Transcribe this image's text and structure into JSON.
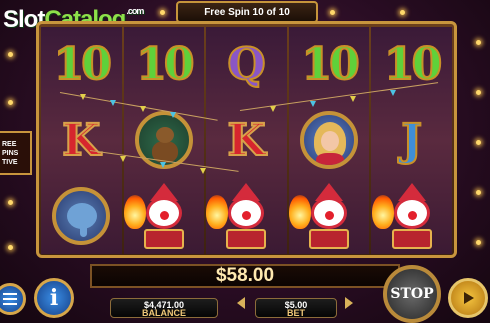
{
  "logo": {
    "slot": "Slot",
    "catalog": "Catalog",
    "com": ".com"
  },
  "header": {
    "free_spin_text": "Free Spin 10 of 10"
  },
  "side_panel": {
    "text_lines": [
      "REE",
      "PINS",
      "TIVE"
    ]
  },
  "reels": [
    [
      "10",
      "K",
      "elephant"
    ],
    [
      "10",
      "bear",
      "clown"
    ],
    [
      "Q",
      "K",
      "clown"
    ],
    [
      "10",
      "girl",
      "clown"
    ],
    [
      "10",
      "J",
      "clown"
    ]
  ],
  "win": {
    "amount": "$58.00"
  },
  "balance": {
    "value": "$4,471.00",
    "label": "BALANCE"
  },
  "bet": {
    "value": "$5.00",
    "label": "BET"
  },
  "buttons": {
    "info_label": "i",
    "stop_label": "STOP"
  },
  "colors": {
    "accent_gold": "#c8953d",
    "ten_green": "#5fd13a",
    "king_red": "#d6262e",
    "queen_purple": "#8a56c6",
    "jack_blue": "#3f8ed8"
  },
  "icons": {
    "menu": "menu-icon",
    "info": "info-icon",
    "play": "play-icon",
    "bet_down": "chevron-left-icon",
    "bet_up": "chevron-right-icon"
  }
}
